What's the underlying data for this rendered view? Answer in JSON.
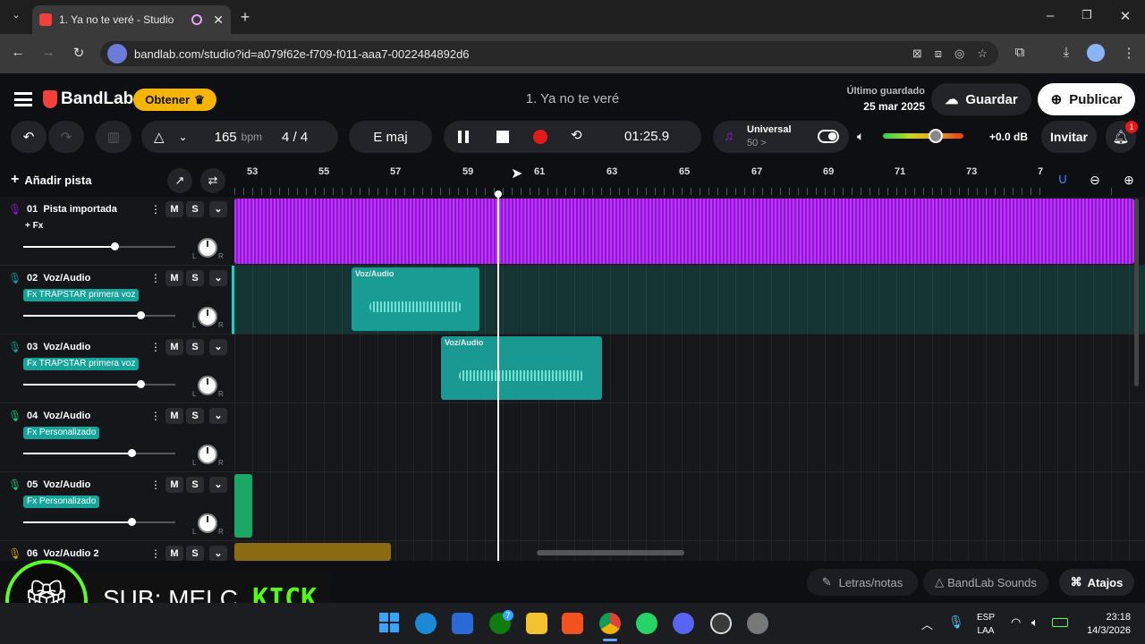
{
  "browser": {
    "tab_title": "1. Ya no te veré - Studio",
    "url": "bandlab.com/studio?id=a079f62e-f709-f011-aaa7-0022484892d6"
  },
  "app": {
    "logo_text": "BandLab",
    "obtener_label": "Obtener",
    "project_title": "1. Ya no te veré",
    "last_saved_label": "Último guardado",
    "last_saved_date": "25 mar 2025",
    "save_label": "Guardar",
    "publish_label": "Publicar"
  },
  "transport": {
    "bpm_value": "165",
    "bpm_unit": "bpm",
    "time_sig": "4 / 4",
    "key": "E maj",
    "time": "01:25.9",
    "universal_label": "Universal",
    "universal_value": "50 >",
    "volume_db": "+0.0 dB",
    "invite_label": "Invitar",
    "notif_count": "1"
  },
  "tracks_header": {
    "add_track_label": "Añadir pista"
  },
  "ruler": [
    "53",
    "55",
    "57",
    "59",
    "61",
    "63",
    "65",
    "67",
    "69",
    "71",
    "73",
    "7"
  ],
  "tracks": [
    {
      "num": "01",
      "name": "Pista importada",
      "fx": "+ Fx",
      "vol": 0.6
    },
    {
      "num": "02",
      "name": "Voz/Audio",
      "fx": "Fx TRAPSTAR primera voz",
      "vol": 0.77
    },
    {
      "num": "03",
      "name": "Voz/Audio",
      "fx": "Fx TRAPSTAR primera voz",
      "vol": 0.77
    },
    {
      "num": "04",
      "name": "Voz/Audio",
      "fx": "Fx Personalizado",
      "vol": 0.71
    },
    {
      "num": "05",
      "name": "Voz/Audio",
      "fx": "Fx Personalizado",
      "vol": 0.71
    },
    {
      "num": "06",
      "name": "Voz/Audio 2",
      "fx": "",
      "vol": 0.7
    }
  ],
  "track_buttons": {
    "mute": "M",
    "solo": "S",
    "pan_l": "L",
    "pan_r": "R"
  },
  "clips": {
    "label": "Voz/Audio"
  },
  "bottom": {
    "letras_label": "Letras/notas",
    "sounds_label": "BandLab Sounds",
    "atajos_label": "Atajos"
  },
  "overlay": {
    "sub_text": "SUB: MELC",
    "kick_text": "KICK"
  },
  "taskbar": {
    "lang": "ESP",
    "lang2": "LAA",
    "time": "23:18",
    "date": "14/3/2026",
    "xbox_badge": "7"
  },
  "colors": {
    "accent": "#16a39a",
    "purple": "#9b10d8",
    "teal_clip": "#1aa89e",
    "gold": "#8a6a12",
    "brand_red": "#f2413c"
  }
}
